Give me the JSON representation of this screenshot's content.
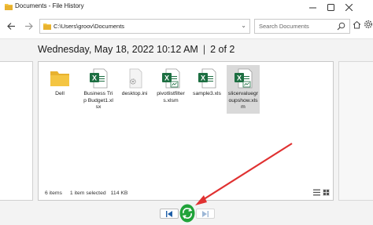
{
  "window": {
    "title": "Documents - File History"
  },
  "toolbar": {
    "address": "C:\\Users\\groov\\Documents",
    "search_placeholder": "Search Documents"
  },
  "heading": {
    "date": "Wednesday, May 18, 2022 10:12 AM",
    "separator": "|",
    "version": "2 of 2"
  },
  "files": [
    {
      "label": "Dell",
      "icon": "folder-icon"
    },
    {
      "label": "Business Trip Budget1.xlsx",
      "icon": "excel-icon"
    },
    {
      "label": "desktop.ini",
      "icon": "settings-file-icon"
    },
    {
      "label": "pivotlistfilters.xlsm",
      "icon": "excel-macro-icon"
    },
    {
      "label": "sample3.xls",
      "icon": "excel-icon"
    },
    {
      "label": "slicervaluegroupshow.xlsm",
      "icon": "excel-macro-icon",
      "selected": true
    }
  ],
  "status": {
    "count": "6 items",
    "selection": "1 item selected",
    "size": "114 KB"
  },
  "colors": {
    "excel_green": "#1d6f42",
    "folder_yellow": "#f4c542",
    "selected_bg": "#d9d9d9",
    "restore_green": "#21a33a",
    "annotation_red": "#e03131"
  }
}
